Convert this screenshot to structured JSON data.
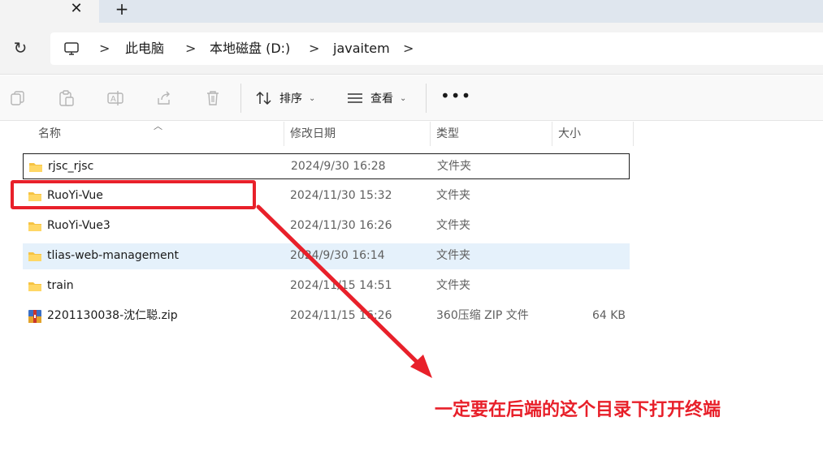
{
  "tabs": {
    "close_icon": "close-icon",
    "new_icon": "plus-icon"
  },
  "address": {
    "refresh_icon": "refresh-icon",
    "pc_icon": "computer-icon",
    "crumbs": [
      "此电脑",
      "本地磁盘 (D:)",
      "javaitem"
    ],
    "separator": ">"
  },
  "toolbar": {
    "icons": [
      "copy-icon",
      "paste-icon",
      "rename-icon",
      "share-icon",
      "delete-icon"
    ],
    "sort_label": "排序",
    "view_label": "查看",
    "more_label": "•••"
  },
  "columns": {
    "name": "名称",
    "date": "修改日期",
    "type": "类型",
    "size": "大小"
  },
  "files": [
    {
      "name": "rjsc_rjsc",
      "date": "2024/9/30 16:28",
      "type": "文件夹",
      "size": "",
      "icon": "folder-icon"
    },
    {
      "name": "RuoYi-Vue",
      "date": "2024/11/30 15:32",
      "type": "文件夹",
      "size": "",
      "icon": "folder-icon"
    },
    {
      "name": "RuoYi-Vue3",
      "date": "2024/11/30 16:26",
      "type": "文件夹",
      "size": "",
      "icon": "folder-icon"
    },
    {
      "name": "tlias-web-management",
      "date": "2024/9/30 16:14",
      "type": "文件夹",
      "size": "",
      "icon": "folder-icon"
    },
    {
      "name": "train",
      "date": "2024/11/15 14:51",
      "type": "文件夹",
      "size": "",
      "icon": "folder-icon"
    },
    {
      "name": "2201130038-沈仁聪.zip",
      "date": "2024/11/15 16:26",
      "type": "360压缩 ZIP 文件",
      "size": "64 KB",
      "icon": "zip-archive-icon"
    }
  ],
  "annotation": {
    "text": "一定要在后端的这个目录下打开终端",
    "color": "#e8202a"
  },
  "colors": {
    "folder": "#f6c343",
    "selection_border": "#1f1f1f",
    "hover": "#e5f1fb"
  }
}
